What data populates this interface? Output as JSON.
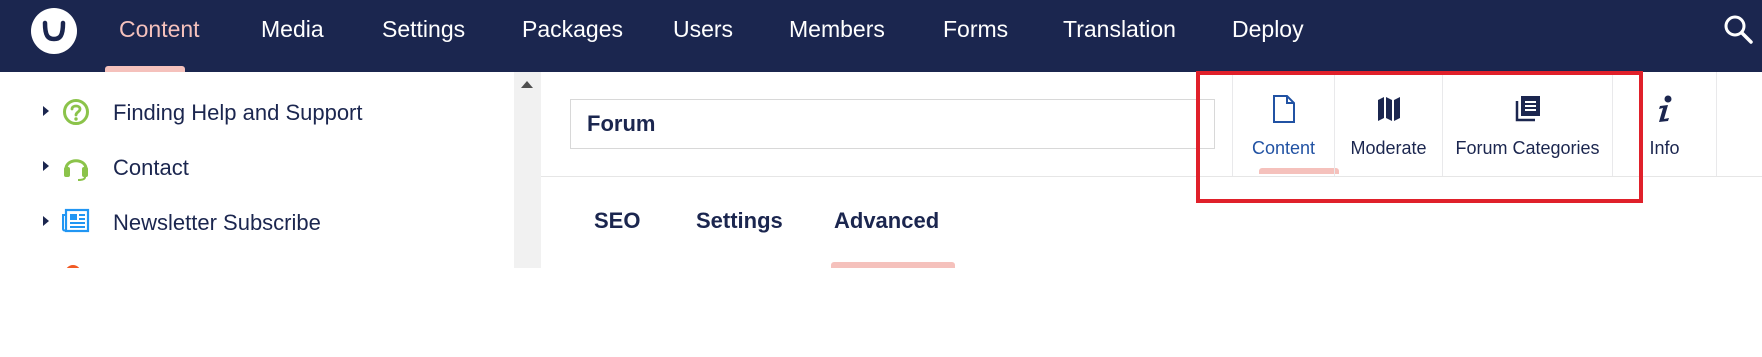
{
  "top_nav": {
    "logo_icon": "umbraco-logo-icon",
    "items": [
      {
        "label": "Content",
        "active": true
      },
      {
        "label": "Media",
        "active": false
      },
      {
        "label": "Settings",
        "active": false
      },
      {
        "label": "Packages",
        "active": false
      },
      {
        "label": "Users",
        "active": false
      },
      {
        "label": "Members",
        "active": false
      },
      {
        "label": "Forms",
        "active": false
      },
      {
        "label": "Translation",
        "active": false
      },
      {
        "label": "Deploy",
        "active": false
      }
    ],
    "search_icon": "search-icon"
  },
  "tree": {
    "items": [
      {
        "label": "Finding Help and Support",
        "icon": "question-circle-icon",
        "icon_color": "#8bc34a"
      },
      {
        "label": "Contact",
        "icon": "headset-icon",
        "icon_color": "#8bc34a"
      },
      {
        "label": "Newsletter Subscribe",
        "icon": "newspaper-icon",
        "icon_color": "#2196f3"
      }
    ],
    "partial_item_icon_color": "#f15a24"
  },
  "editor": {
    "name_value": "Forum",
    "apps": [
      {
        "label": "Content",
        "icon": "document-icon",
        "active": true
      },
      {
        "label": "Moderate",
        "icon": "map-icon",
        "active": false
      },
      {
        "label": "Forum Categories",
        "icon": "categories-icon",
        "active": false
      },
      {
        "label": "Info",
        "icon": "info-icon",
        "active": false
      }
    ],
    "sub_tabs": [
      {
        "label": "SEO",
        "active": false
      },
      {
        "label": "Settings",
        "active": false
      },
      {
        "label": "Advanced",
        "active": true
      }
    ]
  },
  "colors": {
    "nav_background": "#1b264f",
    "active_accent": "#f5c1bc",
    "highlight_border": "#e0202a",
    "active_app_label": "#2152a3"
  }
}
